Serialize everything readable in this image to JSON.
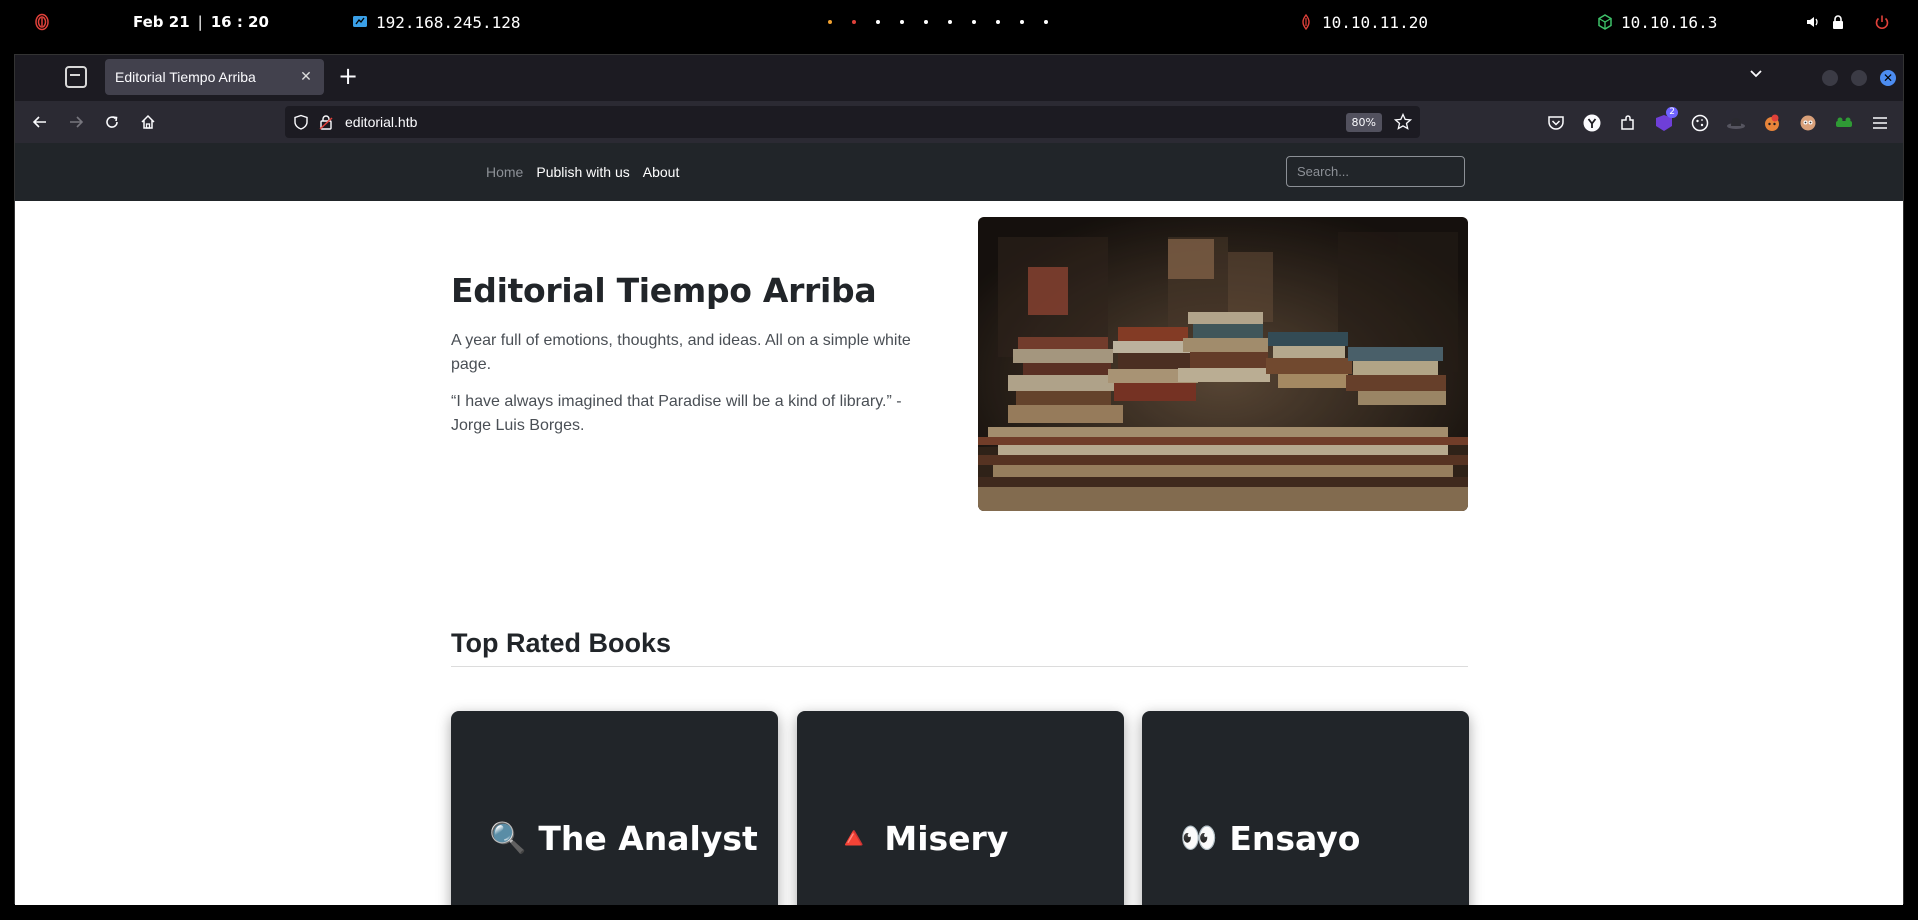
{
  "system_bar": {
    "date": "Feb 21",
    "time": "16 : 20",
    "vm_ip": "192.168.245.128",
    "target_ip": "10.10.11.20",
    "vpn_ip": "10.10.16.3",
    "workspace_count": 10
  },
  "browser": {
    "tab_title": "Editorial Tiempo Arriba",
    "url": "editorial.htb",
    "zoom": "80%",
    "extension_badge": "2"
  },
  "site": {
    "nav": {
      "home": "Home",
      "publish": "Publish with us",
      "about": "About"
    },
    "search_placeholder": "Search...",
    "hero": {
      "title": "Editorial Tiempo Arriba",
      "paragraph1": "A year full of emotions, thoughts, and ideas. All on a simple white page.",
      "paragraph2": "“I have always imagined that Paradise will be a kind of library.” - Jorge Luis Borges."
    },
    "top_rated": {
      "heading": "Top Rated Books",
      "books": [
        {
          "emoji": "🔍",
          "title": "The Analyst"
        },
        {
          "emoji": "🔺",
          "title": "Misery"
        },
        {
          "emoji": "👀",
          "title": "Ensayo"
        }
      ]
    }
  }
}
